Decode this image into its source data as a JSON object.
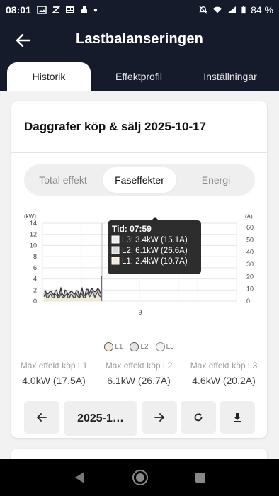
{
  "status": {
    "time": "08:01",
    "battery": "84 %"
  },
  "header": {
    "title": "Lastbalanseringen"
  },
  "tabs": [
    {
      "label": "Historik",
      "active": true
    },
    {
      "label": "Effektprofil",
      "active": false
    },
    {
      "label": "Inställningar",
      "active": false
    }
  ],
  "card": {
    "title": "Daggrafer köp & sälj 2025-10-17",
    "segments": [
      {
        "label": "Total effekt",
        "active": false
      },
      {
        "label": "Faseffekter",
        "active": true
      },
      {
        "label": "Energi",
        "active": false
      }
    ]
  },
  "chart_data": {
    "type": "line",
    "left_unit": "(kW)",
    "right_unit": "(A)",
    "y_left_ticks": [
      "14",
      "12",
      "10",
      "8",
      "6",
      "4",
      "2",
      "0"
    ],
    "y_right_ticks": [
      "60",
      "50",
      "40",
      "30",
      "20",
      "10",
      "0"
    ],
    "ylim_left": [
      0,
      14
    ],
    "ylim_right": [
      0,
      60
    ],
    "x_tick": "9",
    "tooltip": {
      "title": "Tid: 07:59",
      "rows": [
        {
          "text": "L3: 3.4kW (15.1A)",
          "color": "#ececec"
        },
        {
          "text": "L2: 6.1kW (26.6A)",
          "color": "#d8d8d8"
        },
        {
          "text": "L1: 2.4kW (10.7A)",
          "color": "#f1ead6"
        }
      ]
    },
    "series": [
      {
        "name": "L1",
        "color": "#f1ead6",
        "stroke": "#4a4a4a"
      },
      {
        "name": "L2",
        "color": "#d8d8d8",
        "stroke": "#333333"
      },
      {
        "name": "L3",
        "color": "#ececec",
        "stroke": "#555555"
      }
    ]
  },
  "legend": [
    {
      "label": "L1",
      "color": "#f1ead6"
    },
    {
      "label": "L2",
      "color": "#e4e4e4"
    },
    {
      "label": "L3",
      "color": "#f4f4f4"
    }
  ],
  "stats": [
    {
      "label": "Max effekt köp L1",
      "kw": "4.0kW",
      "amp": "(17.5A)"
    },
    {
      "label": "Max effekt köp L2",
      "kw": "6.1kW",
      "amp": "(26.7A)"
    },
    {
      "label": "Max effekt köp L3",
      "kw": "4.6kW",
      "amp": "(20.2A)"
    }
  ],
  "controls": {
    "date_label": "2025-1…"
  },
  "icons": {
    "back": "arrow-left-icon",
    "prev": "arrow-left-icon",
    "next": "arrow-right-icon",
    "refresh": "refresh-icon",
    "download": "download-icon"
  }
}
